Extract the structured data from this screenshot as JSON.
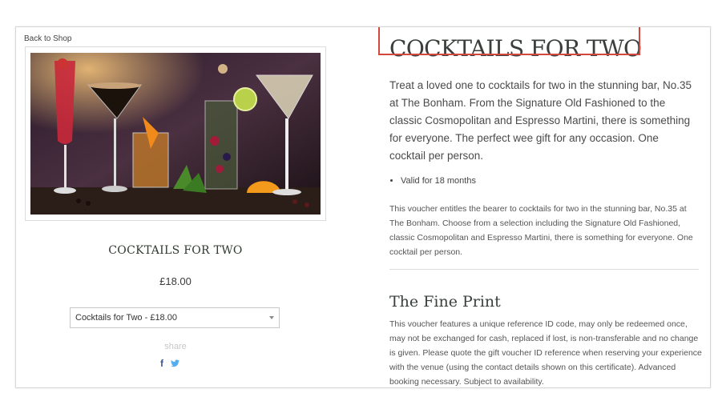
{
  "nav": {
    "back_label": "Back to Shop"
  },
  "product": {
    "title": "COCKTAILS FOR TWO",
    "price": "£18.00",
    "selected_option": "Cocktails for Two - £18.00",
    "share_label": "share",
    "share_icons": [
      "facebook-icon",
      "twitter-icon"
    ]
  },
  "details": {
    "title": "COCKTAILS FOR TWO",
    "lead": "Treat a loved one to cocktails for two in the stunning bar, No.35 at The Bonham. From the Signature Old Fashioned to the classic Cosmopolitan and Espresso Martini, there is something for everyone.  The perfect wee gift for any occasion. One cocktail per person.",
    "bullets": [
      "Valid for 18 months"
    ],
    "description": "This voucher entitles the bearer to cocktails for two in the stunning bar, No.35 at The Bonham. Choose from a selection including the Signature Old Fashioned, classic Cosmopolitan and Espresso Martini, there is something for everyone. One cocktail per person.",
    "fine_print_title": "The Fine Print",
    "fine_print_text": "This voucher features a unique reference ID code, may only be redeemed once, may not be exchanged for cash, replaced if lost, is non-transferable and no change is given. Please quote the gift voucher ID reference when reserving your experience with the venue (using the contact details shown on this certificate). Advanced booking necessary. Subject to availability."
  },
  "colors": {
    "highlight": "#d2483e",
    "facebook": "#3b5998",
    "twitter": "#55acee"
  }
}
